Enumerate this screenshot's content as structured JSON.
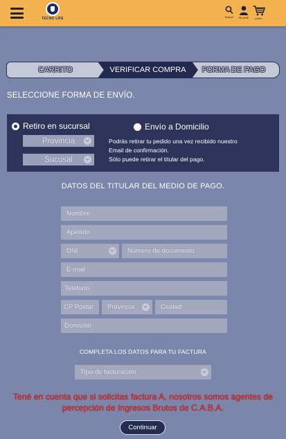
{
  "header": {
    "logo_text": "TECNO LIFE",
    "actions": [
      {
        "label": "buscar",
        "icon": "search-icon"
      },
      {
        "label": "Mi perfil",
        "icon": "user-icon"
      },
      {
        "label": "carrito",
        "icon": "cart-icon"
      }
    ]
  },
  "steps": [
    {
      "label": "CARRITO",
      "state": "inactive"
    },
    {
      "label": "VERIFICAR COMPRA",
      "state": "active"
    },
    {
      "label": "FORMA DE PAGO",
      "state": "inactive"
    }
  ],
  "shipping": {
    "title": "SELECCIONE FORMA DE ENVÍO.",
    "option_pickup": "Retiro en sucursal",
    "option_home": "Envío a Domicilio",
    "selected": "pickup",
    "province_placeholder": "Provincia",
    "branch_placeholder": "Sucusal",
    "note_lines": [
      "Podrás retirar tu pedido una vez recibido nuestro",
      "Email de confirmación.",
      "Sólo puede retirar el titular del pago."
    ]
  },
  "holder": {
    "title": "DATOS DEL TITULAR DEL MEDIO DE PAGO.",
    "name": "Nombre",
    "surname": "Apellido",
    "doc_type": "DNI",
    "doc_number": "Número de documento",
    "email": "E-mail",
    "phone": "Teléfono",
    "postal_code": "CP Postal",
    "province": "Provincia",
    "city": "Ciudad",
    "address": "Domicilio"
  },
  "invoice": {
    "title": "COMPLETA LOS DATOS PARA TU FACTURA",
    "type_placeholder": "Tipo de facturación"
  },
  "warning": "Tené en cuenta que si solicitas factura A, nosotros somos agentes de percepción de Ingresos Brutos de C.A.B.A.",
  "continue_label": "Continuar",
  "colors": {
    "header": "#f3b24f",
    "background": "#7b86ab",
    "panel": "#2d3359",
    "accent_dark": "#242a4f",
    "warning": "#e5221c"
  }
}
